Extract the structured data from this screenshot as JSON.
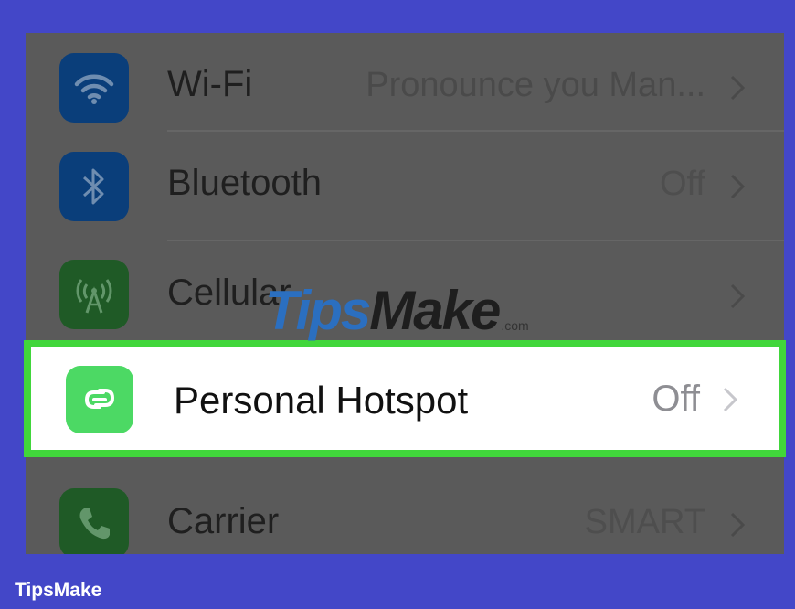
{
  "settings": {
    "rows": [
      {
        "label": "Wi-Fi",
        "value": "Pronounce you Man...",
        "icon": "wifi-icon",
        "icon_color": "#0a3e7a"
      },
      {
        "label": "Bluetooth",
        "value": "Off",
        "icon": "bluetooth-icon",
        "icon_color": "#0a3e7a"
      },
      {
        "label": "Cellular",
        "value": "",
        "icon": "cellular-antenna-icon",
        "icon_color": "#1f5a26"
      },
      {
        "label": "Personal Hotspot",
        "value": "Off",
        "icon": "hotspot-link-icon",
        "icon_color": "#4cd964"
      },
      {
        "label": "Carrier",
        "value": "SMART",
        "icon": "phone-icon",
        "icon_color": "#1f5a26"
      }
    ],
    "highlight_color": "#41d63b"
  },
  "watermark": {
    "text_a": "Tips",
    "text_b": "Make",
    "tld": ".com"
  },
  "footer": {
    "brand": "TipsMake"
  },
  "colors": {
    "background": "#4347c8",
    "panel": "#5a5a5a"
  }
}
